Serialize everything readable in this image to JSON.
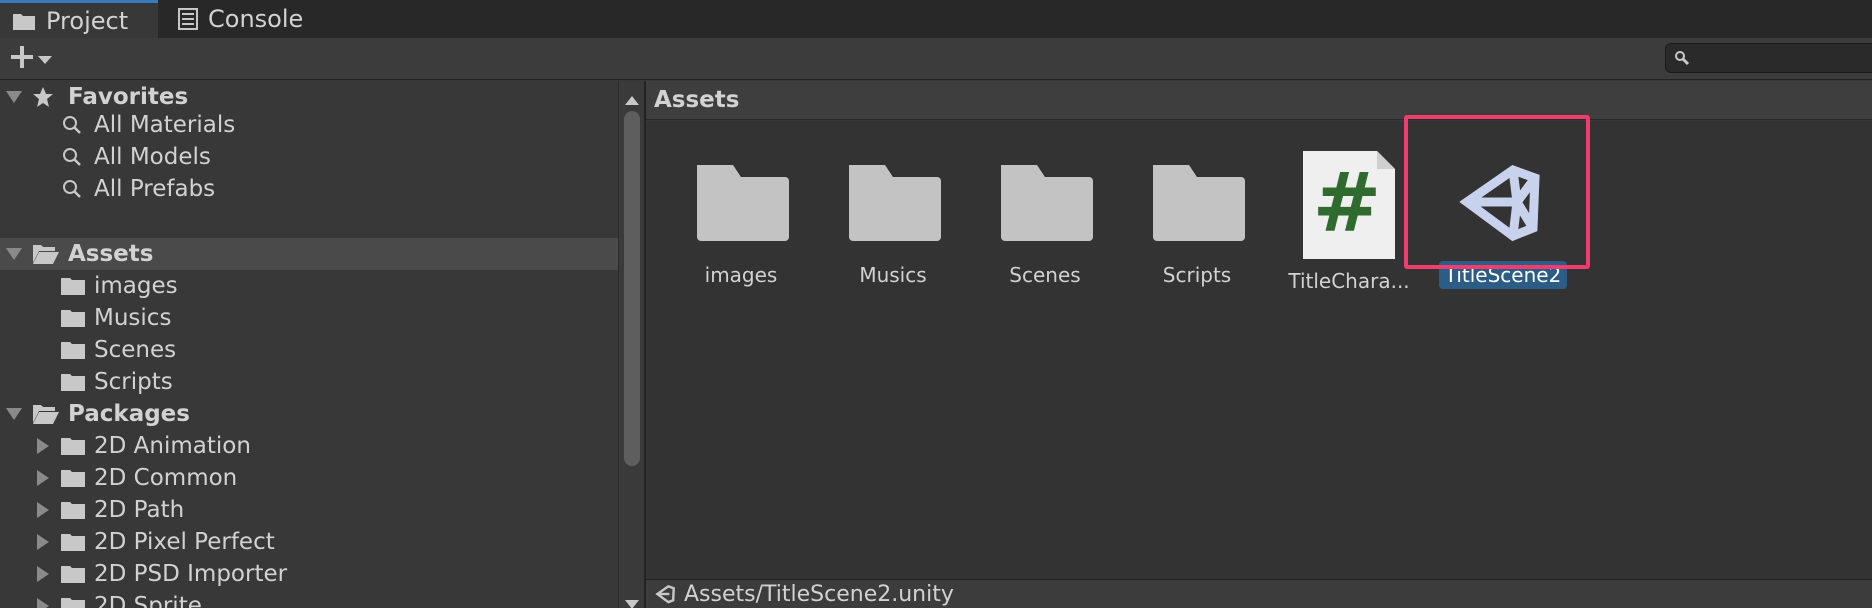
{
  "tabs": {
    "project": "Project",
    "console": "Console"
  },
  "search": {
    "placeholder": ""
  },
  "tree": {
    "favorites": {
      "label": "Favorites",
      "items": [
        "All Materials",
        "All Models",
        "All Prefabs"
      ]
    },
    "assets": {
      "label": "Assets",
      "items": [
        "images",
        "Musics",
        "Scenes",
        "Scripts"
      ]
    },
    "packages": {
      "label": "Packages",
      "items": [
        "2D Animation",
        "2D Common",
        "2D Path",
        "2D Pixel Perfect",
        "2D PSD Importer",
        "2D Sprite"
      ]
    }
  },
  "browser": {
    "header": "Assets",
    "items": [
      {
        "name": "images",
        "kind": "folder-icon"
      },
      {
        "name": "Musics",
        "kind": "folder-icon"
      },
      {
        "name": "Scenes",
        "kind": "folder-icon"
      },
      {
        "name": "Scripts",
        "kind": "folder-icon"
      },
      {
        "name": "TitleChara...",
        "kind": "csharp-script-icon"
      },
      {
        "name": "TitleScene2",
        "kind": "unity-scene-icon",
        "selected": true
      }
    ],
    "footer_path": "Assets/TitleScene2.unity"
  },
  "colors": {
    "accent_tab": "#3a79bb",
    "selection": "#2c5d87",
    "highlight_box": "#ef3d6e",
    "csharp_green": "#2f6b2f",
    "unity_icon": "#c8d2ec"
  }
}
